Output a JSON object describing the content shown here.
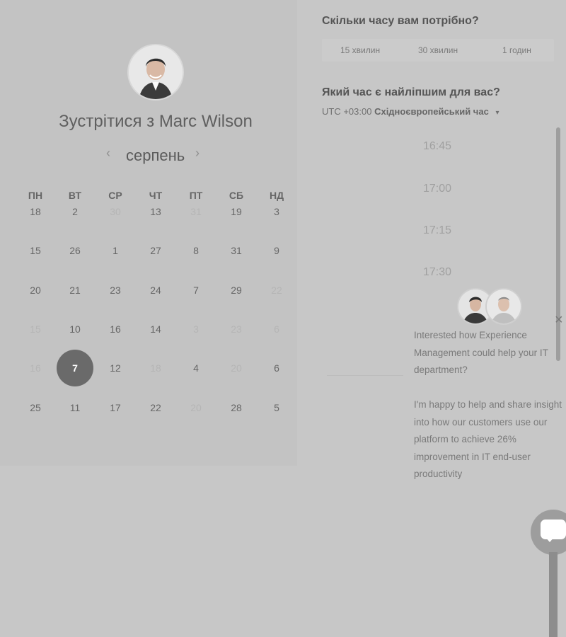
{
  "meeting": {
    "title_prefix": "Зустрітися з",
    "host_name": "Marc Wilson"
  },
  "calendar": {
    "month": "серпень",
    "prev_icon": "chevron-left-icon",
    "next_icon": "chevron-right-icon",
    "weekdays": [
      "ПН",
      "ВТ",
      "СР",
      "ЧТ",
      "ПТ",
      "СБ",
      "НД"
    ],
    "rows": [
      [
        {
          "d": "18"
        },
        {
          "d": "2"
        },
        {
          "d": "30",
          "dim": true
        },
        {
          "d": "13"
        },
        {
          "d": "31",
          "dim": true
        },
        {
          "d": "19"
        },
        {
          "d": "3"
        }
      ],
      [
        {
          "d": "15"
        },
        {
          "d": "26"
        },
        {
          "d": "1"
        },
        {
          "d": "27"
        },
        {
          "d": "8"
        },
        {
          "d": "31"
        },
        {
          "d": "9"
        }
      ],
      [
        {
          "d": "20"
        },
        {
          "d": "21"
        },
        {
          "d": "23"
        },
        {
          "d": "24"
        },
        {
          "d": "7"
        },
        {
          "d": "29"
        },
        {
          "d": "22",
          "dim": true
        }
      ],
      [
        {
          "d": "15",
          "dim": true
        },
        {
          "d": "10"
        },
        {
          "d": "16"
        },
        {
          "d": "14"
        },
        {
          "d": "3",
          "dim": true
        },
        {
          "d": "23",
          "dim": true
        },
        {
          "d": "6",
          "dim": true
        }
      ],
      [
        {
          "d": "16",
          "dim": true
        },
        {
          "d": "7",
          "selected": true
        },
        {
          "d": "12"
        },
        {
          "d": "18",
          "dim": true
        },
        {
          "d": "4"
        },
        {
          "d": "20",
          "dim": true
        },
        {
          "d": "6"
        }
      ],
      [
        {
          "d": "25"
        },
        {
          "d": "11"
        },
        {
          "d": "17"
        },
        {
          "d": "22"
        },
        {
          "d": "20",
          "dim": true
        },
        {
          "d": "28"
        },
        {
          "d": "5"
        }
      ]
    ]
  },
  "duration": {
    "question": "Скільки часу вам потрібно?",
    "options": [
      "15 хвилин",
      "30 хвилин",
      "1 годин"
    ]
  },
  "time": {
    "question": "Який час є найліпшим для вас?",
    "timezone_offset": "UTC +03:00",
    "timezone_name": "Східноєвропейський час",
    "slots": [
      "16:45",
      "17:00",
      "17:15",
      "17:30"
    ]
  },
  "chat": {
    "message_1": "Interested how Experience Management could help your IT department?",
    "message_2": "I'm happy to help and share insight into how our customers use our platform to achieve 26% improvement in IT end-user productivity",
    "close_icon": "close-icon",
    "launcher_icon": "chat-bubble-icon"
  },
  "colors": {
    "overlay_gray": "#c7c7c7",
    "selected_day": "#6a6a6a"
  }
}
